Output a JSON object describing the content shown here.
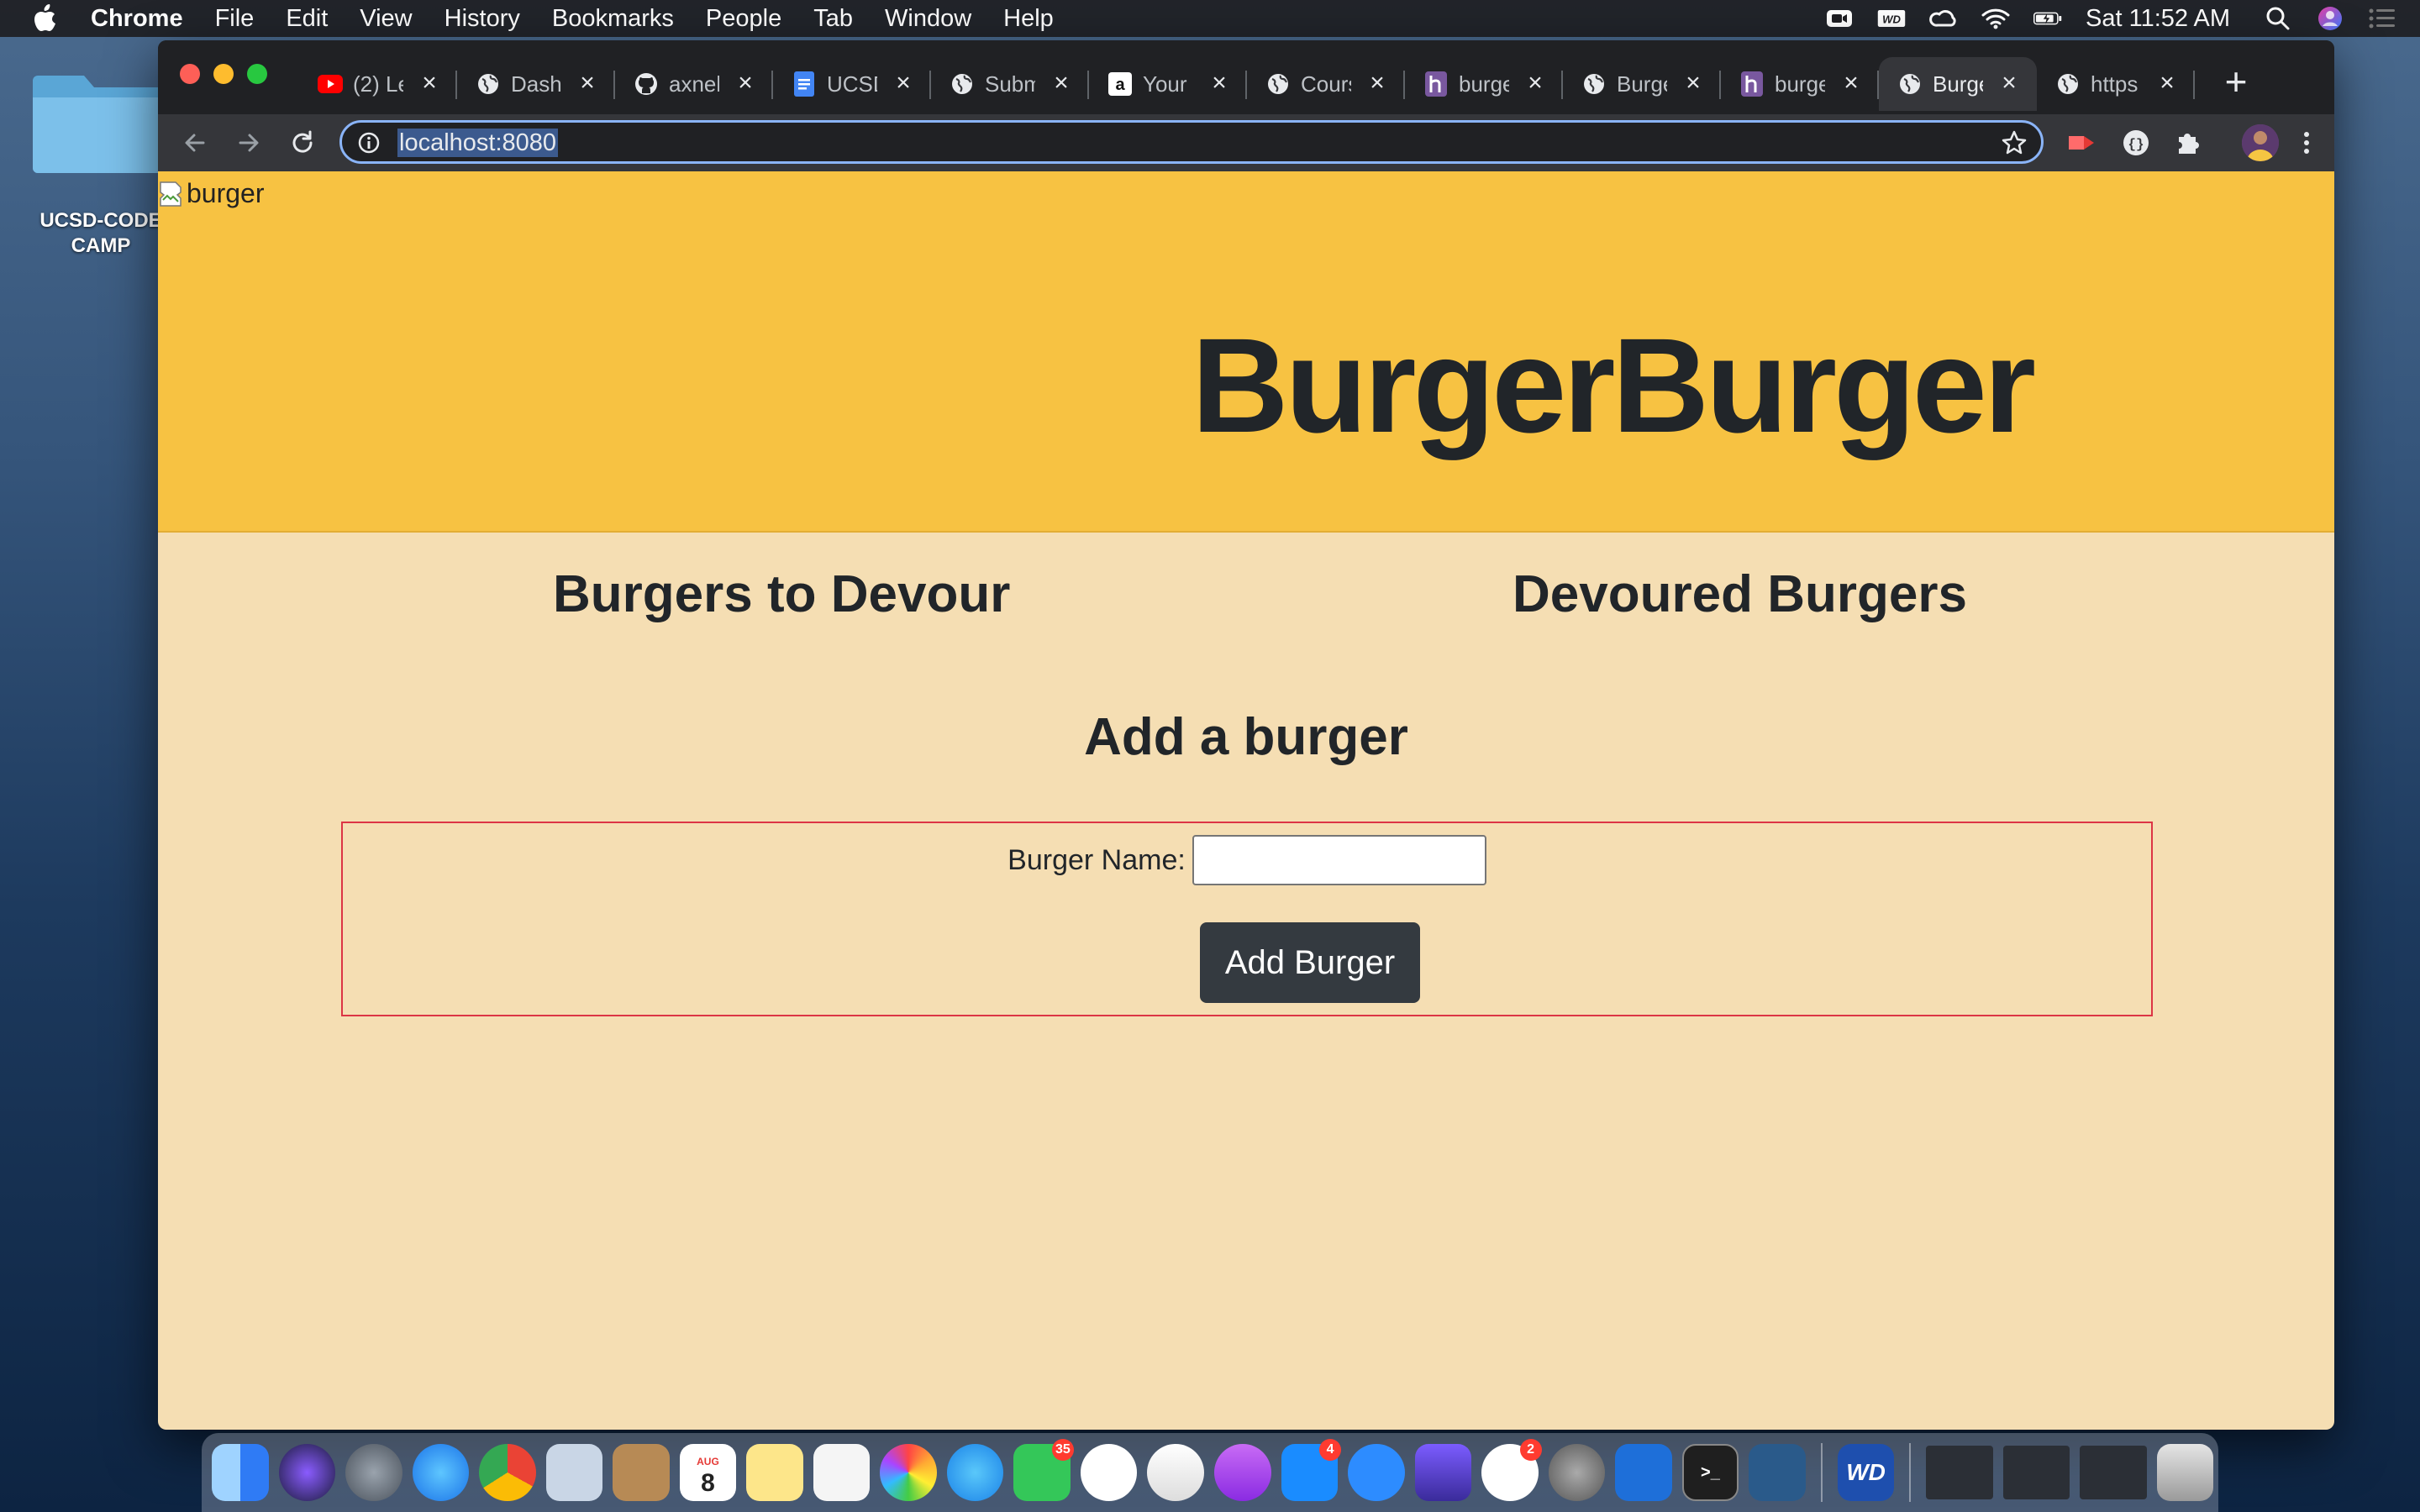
{
  "menubar": {
    "app": "Chrome",
    "items": [
      "File",
      "Edit",
      "View",
      "History",
      "Bookmarks",
      "People",
      "Tab",
      "Window",
      "Help"
    ],
    "clock": "Sat 11:52 AM",
    "status_icons": [
      "zoom-icon",
      "wd-icon",
      "creative-cloud-icon",
      "wifi-icon",
      "battery-icon",
      "spotlight-icon",
      "siri-icon",
      "notification-center-icon"
    ]
  },
  "desktop": {
    "folder_label": "UCSD-CODE CAMP"
  },
  "browser": {
    "tabs": [
      {
        "title": "(2) Le",
        "icon": "youtube-icon"
      },
      {
        "title": "Dashb",
        "icon": "globe-icon"
      },
      {
        "title": "axnel",
        "icon": "github-icon"
      },
      {
        "title": "UCSD",
        "icon": "docs-icon"
      },
      {
        "title": "Subm",
        "icon": "globe-icon"
      },
      {
        "title": "Your",
        "icon": "amazon-icon"
      },
      {
        "title": "Cours",
        "icon": "globe-icon"
      },
      {
        "title": "burge",
        "icon": "heroku-icon"
      },
      {
        "title": "Burge",
        "icon": "globe-icon"
      },
      {
        "title": "burge",
        "icon": "heroku-icon"
      },
      {
        "title": "Burge",
        "icon": "globe-icon",
        "active": true
      },
      {
        "title": "https",
        "icon": "globe-icon"
      }
    ],
    "url": "localhost:8080"
  },
  "page": {
    "broken_image_alt": "burger",
    "title": "BurgerBurger",
    "col_left_heading": "Burgers to Devour",
    "col_right_heading": "Devoured Burgers",
    "add_heading": "Add a burger",
    "form": {
      "label": "Burger Name:",
      "input_value": "",
      "button_label": "Add Burger"
    }
  },
  "dock": {
    "badges": {
      "facetime": "35",
      "app_store": "4",
      "slack": "2"
    },
    "calendar_day": "8",
    "calendar_month": "AUG",
    "wd_label": "WD"
  },
  "colors": {
    "jumbotron": "#f7c242",
    "page_bg": "#f5deb3",
    "button": "#343a40",
    "form_border": "#dc3545"
  }
}
